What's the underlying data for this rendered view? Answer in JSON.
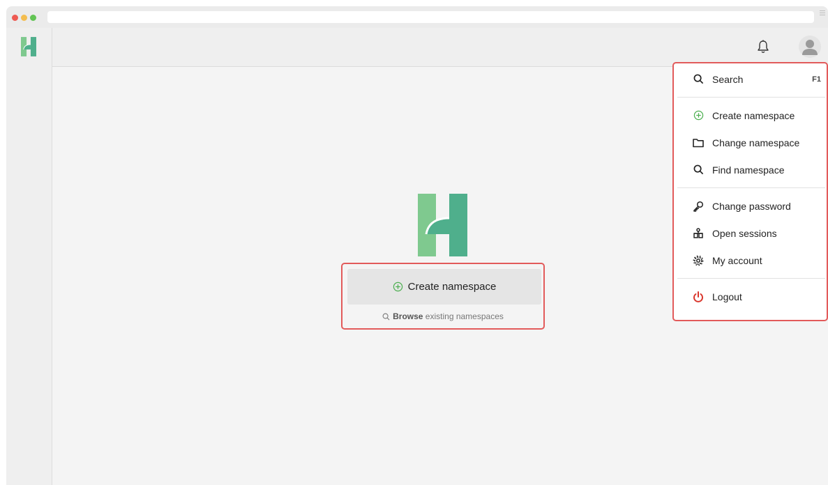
{
  "header": {
    "notifications_icon": "bell-icon",
    "avatar_icon": "user-avatar-icon"
  },
  "center": {
    "create_label": "Create namespace",
    "browse_bold": "Browse",
    "browse_rest": " existing namespaces"
  },
  "menu": {
    "search_label": "Search",
    "search_shortcut": "F1",
    "create_label": "Create namespace",
    "change_label": "Change namespace",
    "find_label": "Find namespace",
    "password_label": "Change password",
    "sessions_label": "Open sessions",
    "account_label": "My account",
    "logout_label": "Logout"
  },
  "colors": {
    "brand_green_light": "#7fc98f",
    "brand_green_dark": "#4faf8c",
    "highlight_red": "#e25a5a",
    "logout_red": "#d9352b",
    "plus_green": "#4caf50"
  }
}
